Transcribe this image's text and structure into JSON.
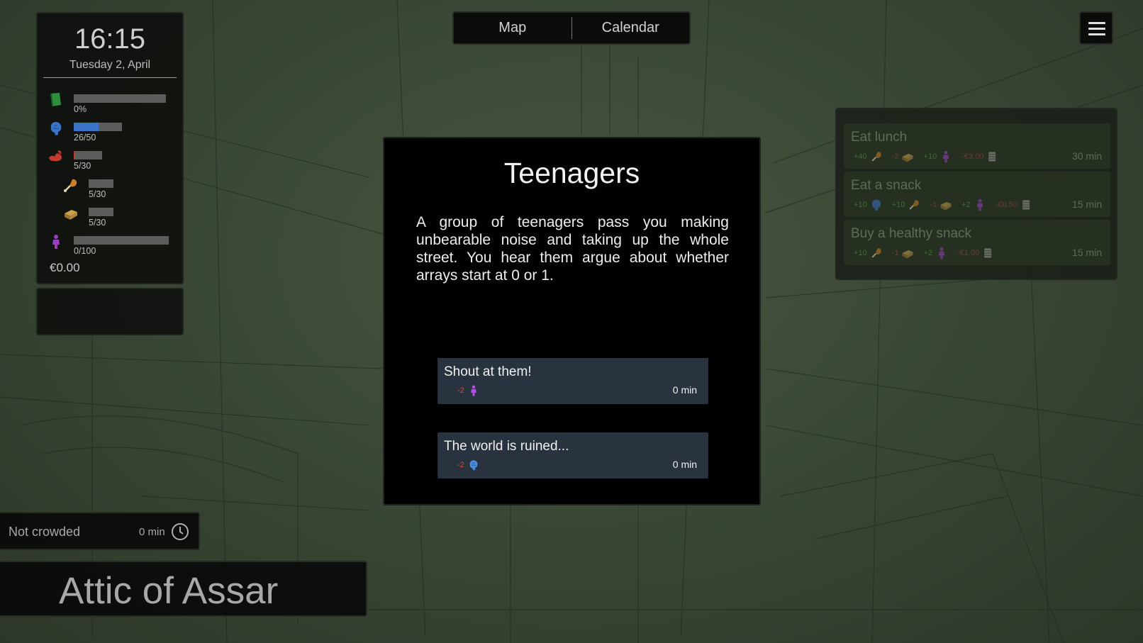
{
  "clock": {
    "time": "16:15",
    "date": "Tuesday 2, April"
  },
  "stats": [
    {
      "icon": "book-icon",
      "value_text": "0%",
      "fraction": 0.0,
      "color": "#2f8f3f"
    },
    {
      "icon": "brain-icon",
      "value_text": "26/50",
      "fraction": 0.52,
      "color": "#3a73c7"
    },
    {
      "icon": "muscle-icon",
      "value_text": "5/30",
      "fraction": 0.05,
      "color": "#c43a2e"
    },
    {
      "icon": "drumstick-icon",
      "value_text": "5/30",
      "fraction": 0.0,
      "color": "#c8812a"
    },
    {
      "icon": "bread-icon",
      "value_text": "5/30",
      "fraction": 0.0,
      "color": "#c9a04c"
    },
    {
      "icon": "person-icon",
      "value_text": "0/100",
      "fraction": 0.0,
      "color": "#9a3fc4"
    }
  ],
  "money": "€0.00",
  "tabs": {
    "map": "Map",
    "calendar": "Calendar"
  },
  "actions": [
    {
      "title": "Eat lunch",
      "effects": [
        {
          "value": "+40",
          "icon": "drumstick-icon"
        },
        {
          "value": "-2",
          "icon": "bread-icon"
        },
        {
          "value": "+10",
          "icon": "person-icon"
        },
        {
          "value": "-€3.00",
          "icon": "coins-icon"
        }
      ],
      "time": "30 min"
    },
    {
      "title": "Eat a snack",
      "effects": [
        {
          "value": "+10",
          "icon": "brain-icon"
        },
        {
          "value": "+10",
          "icon": "drumstick-icon"
        },
        {
          "value": "-1",
          "icon": "bread-icon"
        },
        {
          "value": "+2",
          "icon": "person-icon"
        },
        {
          "value": "-€0.50",
          "icon": "coins-icon"
        }
      ],
      "time": "15 min"
    },
    {
      "title": "Buy a healthy snack",
      "effects": [
        {
          "value": "+10",
          "icon": "drumstick-icon"
        },
        {
          "value": "-1",
          "icon": "bread-icon"
        },
        {
          "value": "+2",
          "icon": "person-icon"
        },
        {
          "value": "-€1.00",
          "icon": "coins-icon"
        }
      ],
      "time": "15 min"
    }
  ],
  "event": {
    "title": "Teenagers",
    "text": "A group of teenagers pass you making unbearable noise and taking up the whole street. You hear them argue about whether arrays start at 0 or 1.",
    "choices": [
      {
        "label": "Shout at them!",
        "effect_value": "-2",
        "effect_icon": "person-icon",
        "time": "0 min"
      },
      {
        "label": "The world is ruined...",
        "effect_value": "-2",
        "effect_icon": "brain-icon",
        "time": "0 min"
      }
    ]
  },
  "crowd": {
    "status": "Not crowded",
    "time": "0 min"
  },
  "location": "Attic of Assar"
}
